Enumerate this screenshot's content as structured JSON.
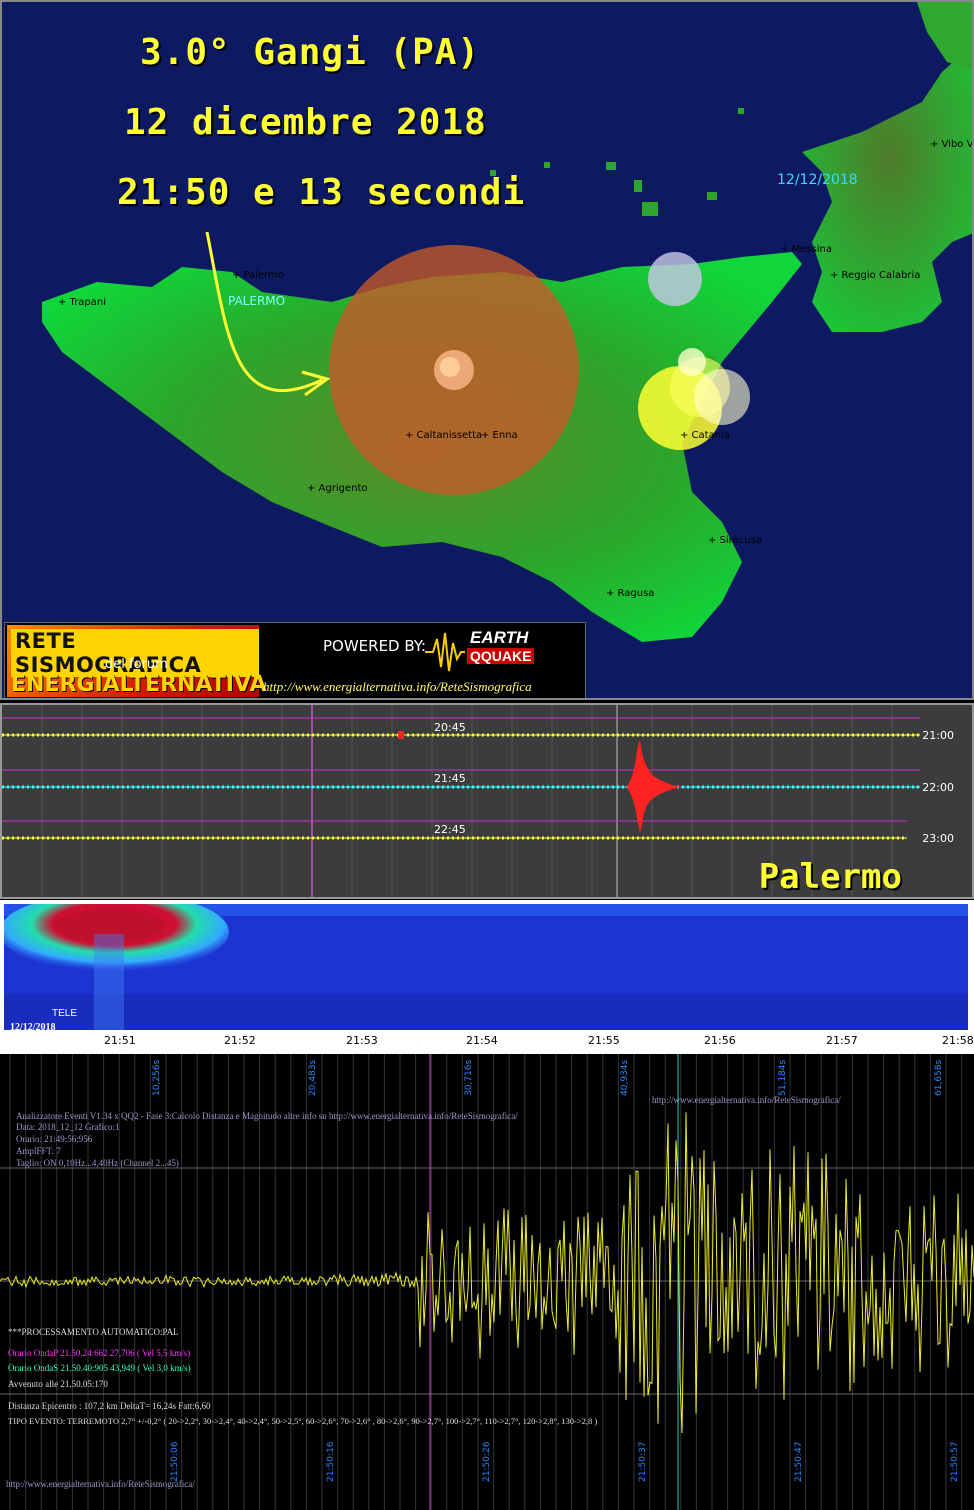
{
  "event": {
    "title_line1": "3.0° Gangi (PA)",
    "title_line2": "12 dicembre 2018",
    "title_line3": "21:50 e 13 secondi",
    "map_date": "12/12/2018"
  },
  "cities": [
    {
      "name": "+ Palermo"
    },
    {
      "name": "+ Trapani"
    },
    {
      "name": "+ Caltanissetta"
    },
    {
      "name": "+ Enna"
    },
    {
      "name": "+ Agrigento"
    },
    {
      "name": "+ Catania"
    },
    {
      "name": "+ Siracusa"
    },
    {
      "name": "+ Ragusa"
    },
    {
      "name": "+ Messina"
    },
    {
      "name": "+ Reggio Calabria"
    },
    {
      "name": "+ Vibo Va"
    }
  ],
  "station_label": "PALERMO",
  "logo": {
    "rete": "RETE SISMOGRAFICA",
    "del_forum": "del forum",
    "energ": "ENERGIALTERNATIVA",
    "powered": "POWERED BY:",
    "earth": "EARTH",
    "qquake": "QQUAKE",
    "url": "http://www.energialternativa.info/ReteSismografica"
  },
  "helicorder": {
    "station": "Palermo",
    "rows": [
      {
        "left": "20:45",
        "right": "21:00",
        "color": "#ffff33"
      },
      {
        "left": "21:45",
        "right": "22:00",
        "color": "#33ffff"
      },
      {
        "left": "22:45",
        "right": "23:00",
        "color": "#ffff33"
      }
    ]
  },
  "spectrogram": {
    "tele": "TELE",
    "date": "12/12/2018",
    "ticks": [
      "21:51",
      "21:52",
      "21:53",
      "21:54",
      "21:55",
      "21:56",
      "21:57",
      "21:58"
    ]
  },
  "analyzer": {
    "top_ticks": [
      "10,256s",
      "20,483s",
      "30,716s",
      "40,934s",
      "51,184s",
      "61,658s"
    ],
    "bottom_ticks": [
      "21:50:06",
      "21:50:16",
      "21:50:26",
      "21:50:37",
      "21:50:47",
      "21:50:57"
    ],
    "url_right": "http://www.energialternativa.info/ReteSismografica/",
    "info_lines": [
      "Analizzatore Eventi V1.34 x QQ2 - Fase 3:Calcolo Distanza e Magnitudo altre info su http://www.energialternativa.info/ReteSismografica/",
      "Data: 2018_12_12 Grafico:1",
      "Orario: 21:49:56:956",
      "AmplFFT: 7",
      "Taglio: ON 0,10Hz...4,40Hz      (Channel 2...45)"
    ],
    "processing": "***PROCESSAMENTO AUTOMATICO:PAL",
    "onda_p": "Orario OndaP 21.50.24:662  27,706 ( Vel 5,5 km/s)",
    "onda_s": "Orario OndaS 21.50.40:905  43,949 ( Vel 3,0 km/s)",
    "avvenuto": "Avvenuto alle 21.50.05:170",
    "distanza": "Distanza Epicentro : 107,2 km DeltaT= 16,24s  Fatt:6,60",
    "tipo": "TIPO EVENTO: TERREMOTO 2,7° +/-0,2° ( 20->2,2°, 30->2,4°, 40->2,4°, 50->2,5°, 60->2,6°, 70->2,6° , 80->2,6°, 90->2,7°, 100->2,7°, 110->2,7°, 120->2,8°, 130->2,8 )",
    "url_bottom": "http://www.energialternativa.info/ReteSismografica/"
  },
  "colors": {
    "map_sea": "#0d1a62",
    "land": "#2fa82f",
    "title": "#ffff33",
    "event_circle": "#c85a28",
    "catania_circle": "#ffff33"
  }
}
